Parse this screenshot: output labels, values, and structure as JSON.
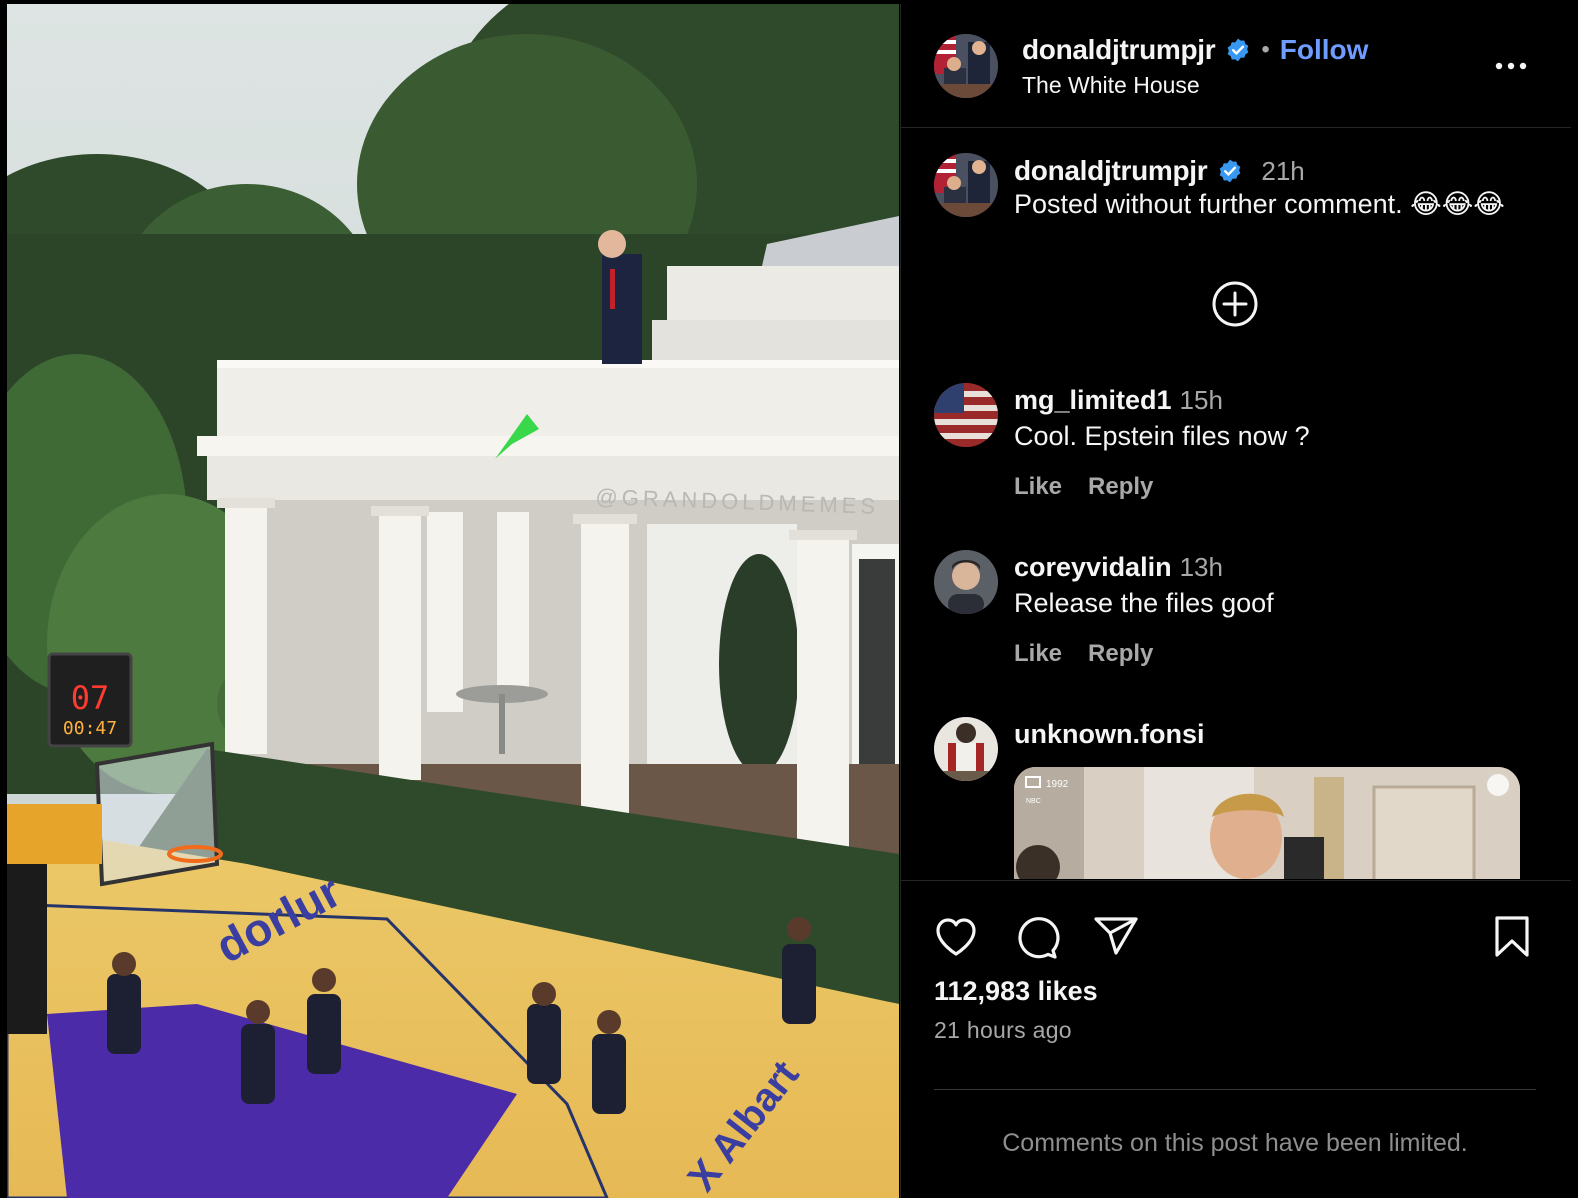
{
  "post": {
    "author": "donaldjtrumpjr",
    "location": "The White House",
    "follow_label": "Follow",
    "separator": "•",
    "caption_author": "donaldjtrumpjr",
    "caption_time": "21h",
    "caption_text": "Posted without further comment. 😂😂😂",
    "watermark": "@GRANDOLDMEMES",
    "scoreboard_score": "07",
    "scoreboard_clock": "00:47",
    "court_text_left": "dorlur",
    "court_text_right": "X Albart"
  },
  "comments": [
    {
      "user": "mg_limited1",
      "time": "15h",
      "text": "Cool. Epstein files now ?",
      "like_label": "Like",
      "reply_label": "Reply"
    },
    {
      "user": "coreyvidalin",
      "time": "13h",
      "text": "Release the files goof",
      "like_label": "Like",
      "reply_label": "Reply"
    },
    {
      "user": "unknown.fonsi",
      "video_year": "1992",
      "video_source": "NBC"
    }
  ],
  "footer": {
    "likes": "112,983 likes",
    "posted_ago": "21 hours ago",
    "comments_limited": "Comments on this post have been limited."
  },
  "icons": [
    "more-options-icon",
    "verified-badge-icon",
    "add-comment-icon",
    "heart-icon",
    "comment-icon",
    "share-icon",
    "bookmark-icon"
  ],
  "colors": {
    "background": "#000000",
    "follow": "#6f9cff",
    "verified": "#3897f0",
    "muted": "#a8a8a8"
  }
}
